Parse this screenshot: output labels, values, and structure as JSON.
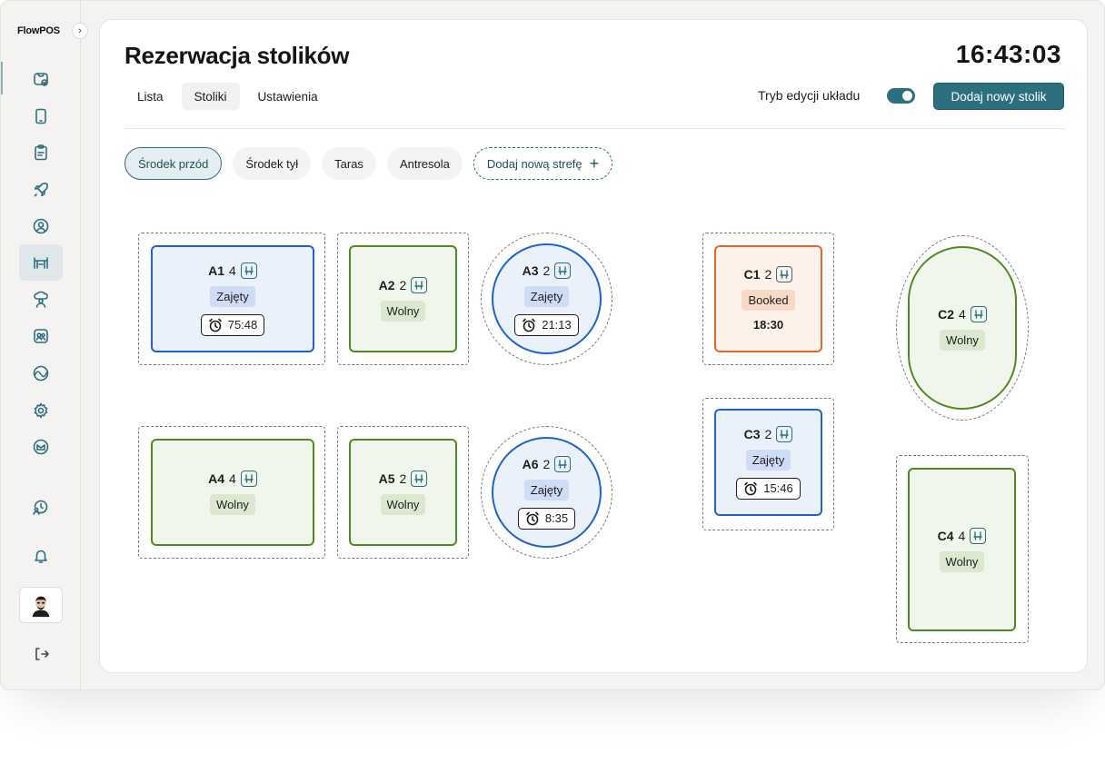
{
  "app": {
    "logo": "FlowPOS",
    "collapse_glyph": "›"
  },
  "sidebar": {
    "items": [
      {
        "icon": "basket-check-icon"
      },
      {
        "icon": "tablet-icon"
      },
      {
        "icon": "clipboard-icon"
      },
      {
        "icon": "rocket-icon"
      },
      {
        "icon": "user-circle-icon"
      },
      {
        "icon": "table-layout-icon",
        "active": true
      },
      {
        "icon": "chef-icon"
      },
      {
        "icon": "contacts-icon"
      },
      {
        "icon": "analytics-icon"
      },
      {
        "icon": "settings-gear-icon"
      },
      {
        "icon": "mailbox-icon"
      },
      {
        "icon": "user-history-icon"
      },
      {
        "icon": "bell-icon"
      },
      {
        "icon": "logout-icon"
      }
    ]
  },
  "header": {
    "title": "Rezerwacja stolików",
    "clock": "16:43:03",
    "tabs": [
      {
        "label": "Lista"
      },
      {
        "label": "Stoliki",
        "active": true
      },
      {
        "label": "Ustawienia"
      }
    ],
    "edit_mode_label": "Tryb edycji układu",
    "edit_mode_on": true,
    "add_table_label": "Dodaj nowy stolik"
  },
  "zones": {
    "items": [
      {
        "label": "Środek przód",
        "active": true
      },
      {
        "label": "Środek tył"
      },
      {
        "label": "Taras"
      },
      {
        "label": "Antresola"
      }
    ],
    "add_label": "Dodaj nową strefę",
    "add_glyph": "+"
  },
  "tables": [
    {
      "name": "A1",
      "seats": "4",
      "status": "Zajęty",
      "timer": "75:48"
    },
    {
      "name": "A2",
      "seats": "2",
      "status": "Wolny"
    },
    {
      "name": "A3",
      "seats": "2",
      "status": "Zajęty",
      "timer": "21:13"
    },
    {
      "name": "A4",
      "seats": "4",
      "status": "Wolny"
    },
    {
      "name": "A5",
      "seats": "2",
      "status": "Wolny"
    },
    {
      "name": "A6",
      "seats": "2",
      "status": "Zajęty",
      "timer": "8:35"
    },
    {
      "name": "C1",
      "seats": "2",
      "status": "Booked",
      "booking_time": "18:30"
    },
    {
      "name": "C2",
      "seats": "4",
      "status": "Wolny"
    },
    {
      "name": "C3",
      "seats": "2",
      "status": "Zajęty",
      "timer": "15:46"
    },
    {
      "name": "C4",
      "seats": "4",
      "status": "Wolny"
    }
  ],
  "colors": {
    "accent": "#2c6f7e",
    "free_border": "#4f8c20",
    "busy_border": "#1f64c8",
    "booked_border": "#e0692c"
  }
}
